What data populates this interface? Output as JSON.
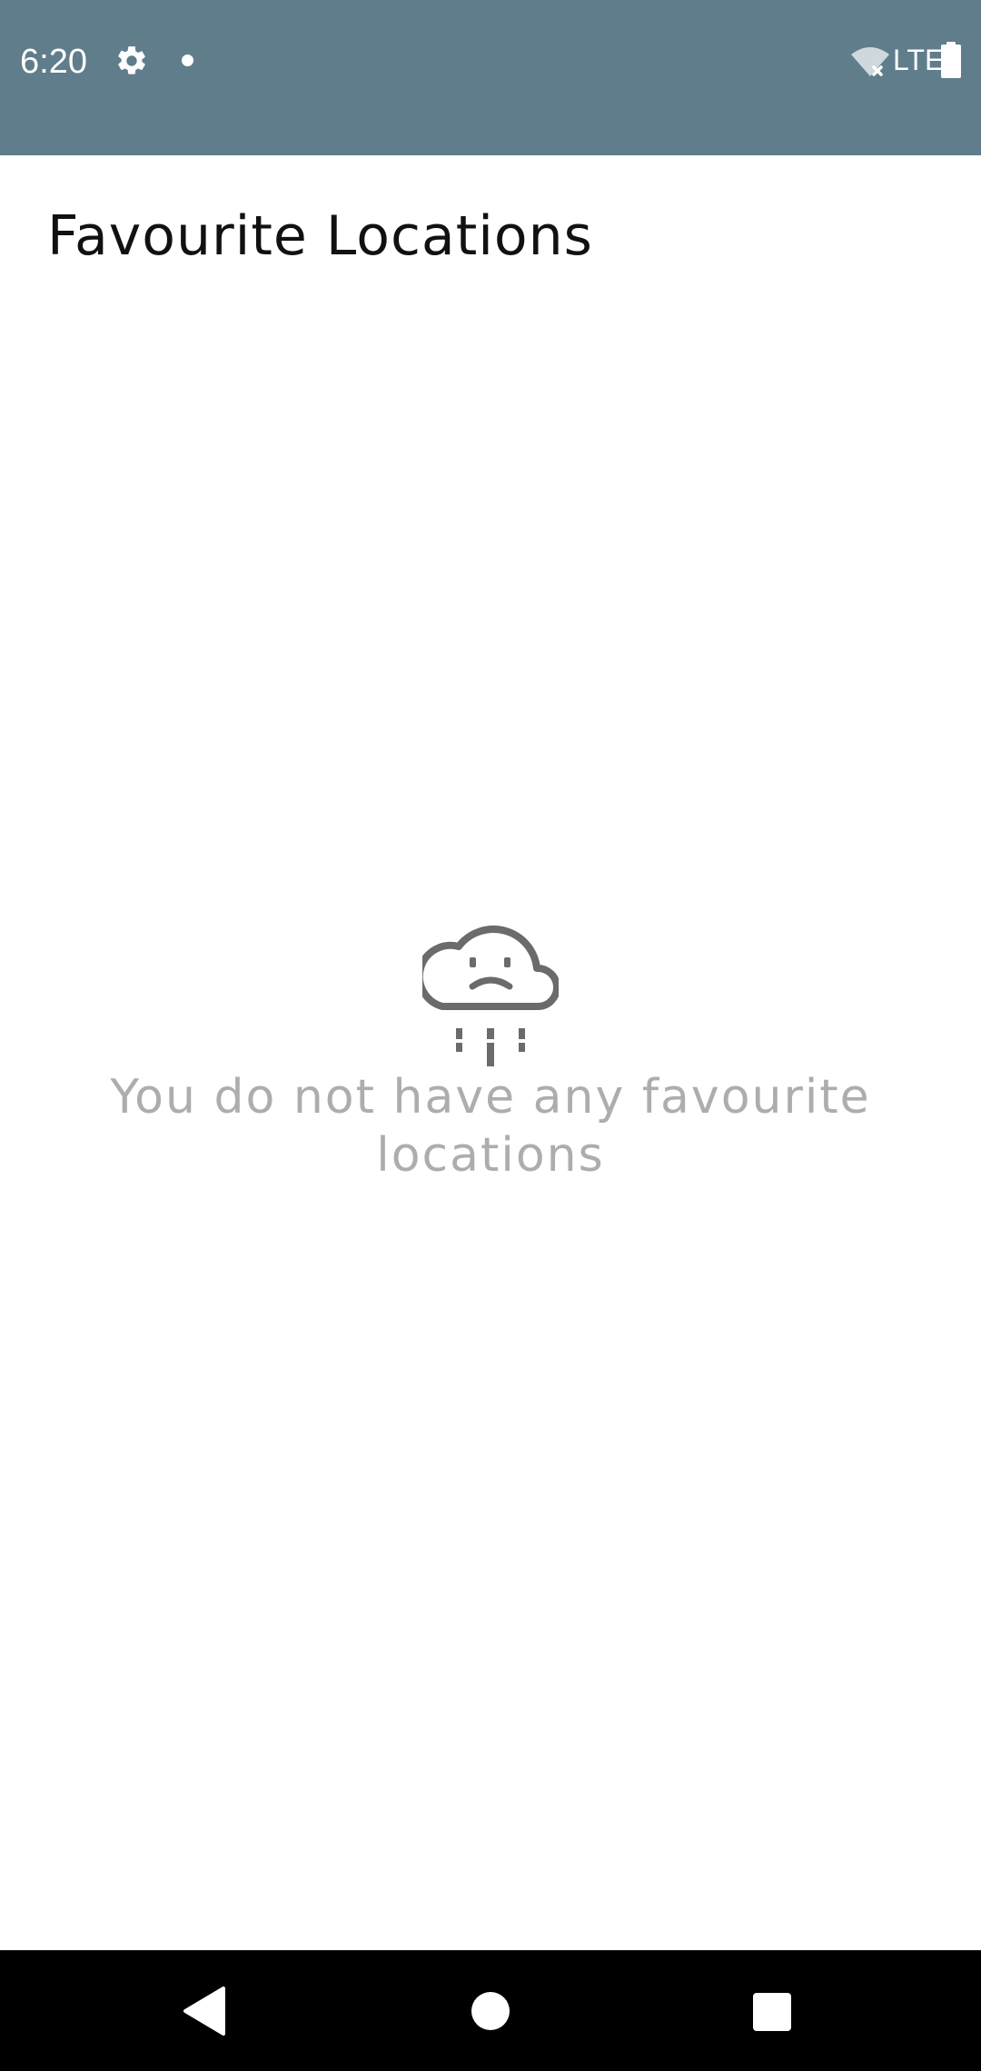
{
  "status_bar": {
    "time": "6:20",
    "network_label": "LTE",
    "background_color": "#607D8B",
    "icons": [
      "gear-icon",
      "notification-dot-icon",
      "wifi-off-icon",
      "battery-icon"
    ]
  },
  "header": {
    "title": "Favourite Locations"
  },
  "empty_state": {
    "icon": "sad-cloud-icon",
    "message": "You do not have any favourite locations"
  },
  "navigation_bar": {
    "icons": [
      "back-icon",
      "home-icon",
      "recents-icon"
    ]
  }
}
